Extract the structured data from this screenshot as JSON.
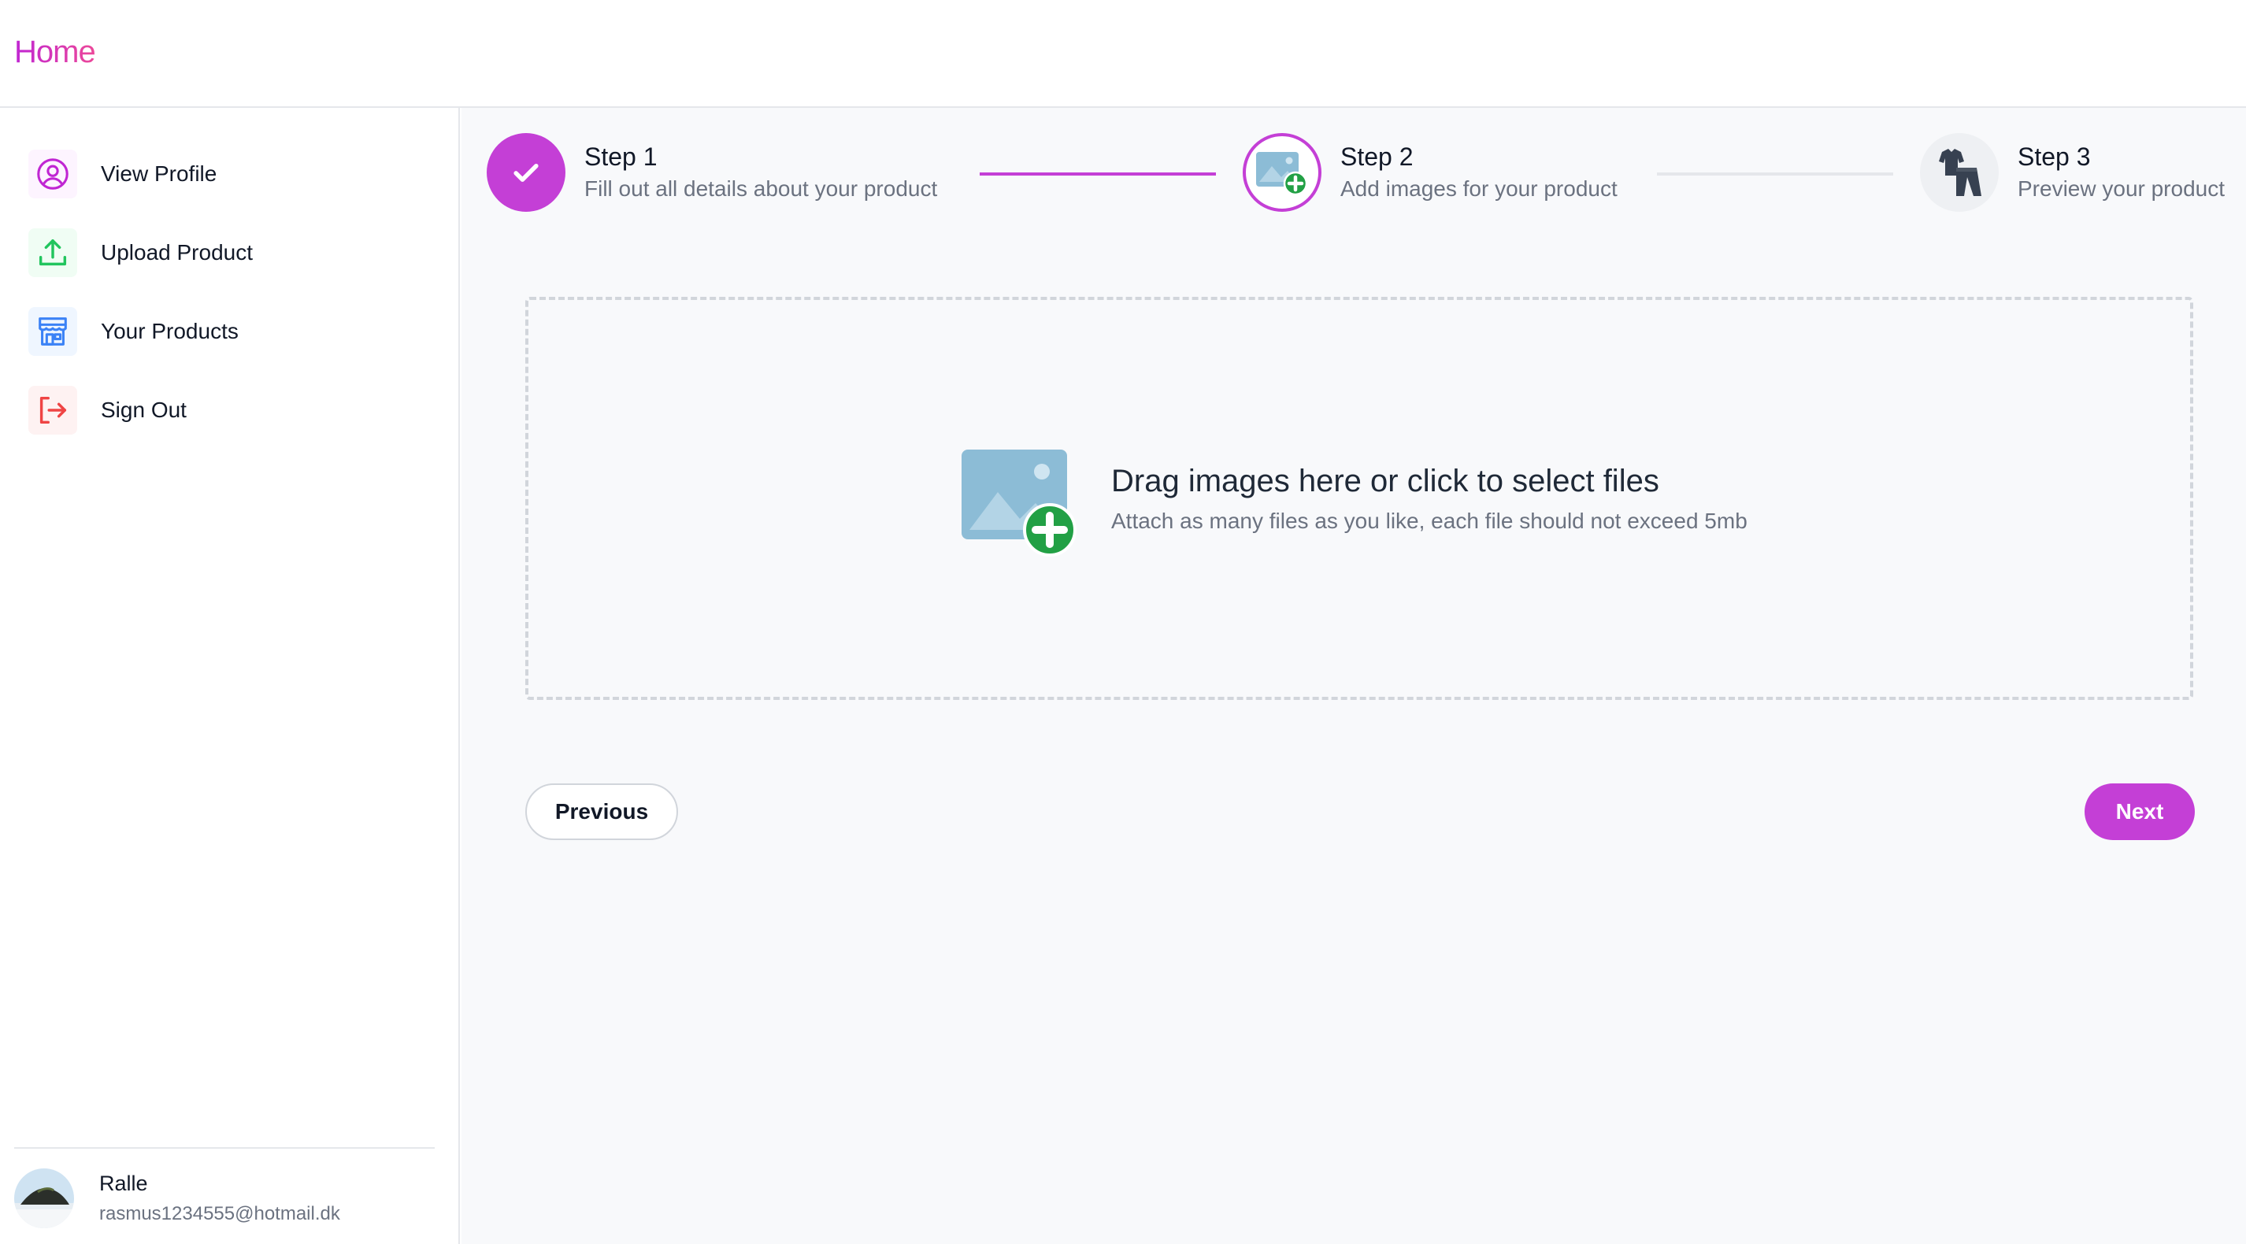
{
  "header": {
    "home_label": "Home"
  },
  "sidebar": {
    "items": [
      {
        "label": "View Profile",
        "icon": "user-circle-icon",
        "color": "#c026d3",
        "bg": "#fdf4ff"
      },
      {
        "label": "Upload Product",
        "icon": "upload-icon",
        "color": "#22c55e",
        "bg": "#f0fdf4"
      },
      {
        "label": "Your Products",
        "icon": "storefront-icon",
        "color": "#3b82f6",
        "bg": "#eff6ff"
      },
      {
        "label": "Sign Out",
        "icon": "sign-out-icon",
        "color": "#ef4444",
        "bg": "#fef2f2"
      }
    ],
    "user": {
      "name": "Ralle",
      "email": "rasmus1234555@hotmail.dk"
    }
  },
  "stepper": {
    "steps": [
      {
        "title": "Step 1",
        "description": "Fill out all details about your product",
        "status": "complete"
      },
      {
        "title": "Step 2",
        "description": "Add images for your product",
        "status": "current"
      },
      {
        "title": "Step 3",
        "description": "Preview your product",
        "status": "upcoming"
      }
    ],
    "accent_color": "#c43fd6"
  },
  "dropzone": {
    "title": "Drag images here or click to select files",
    "subtitle": "Attach as many files as you like, each file should not exceed 5mb",
    "icon": "add-image-icon"
  },
  "buttons": {
    "previous_label": "Previous",
    "next_label": "Next"
  }
}
